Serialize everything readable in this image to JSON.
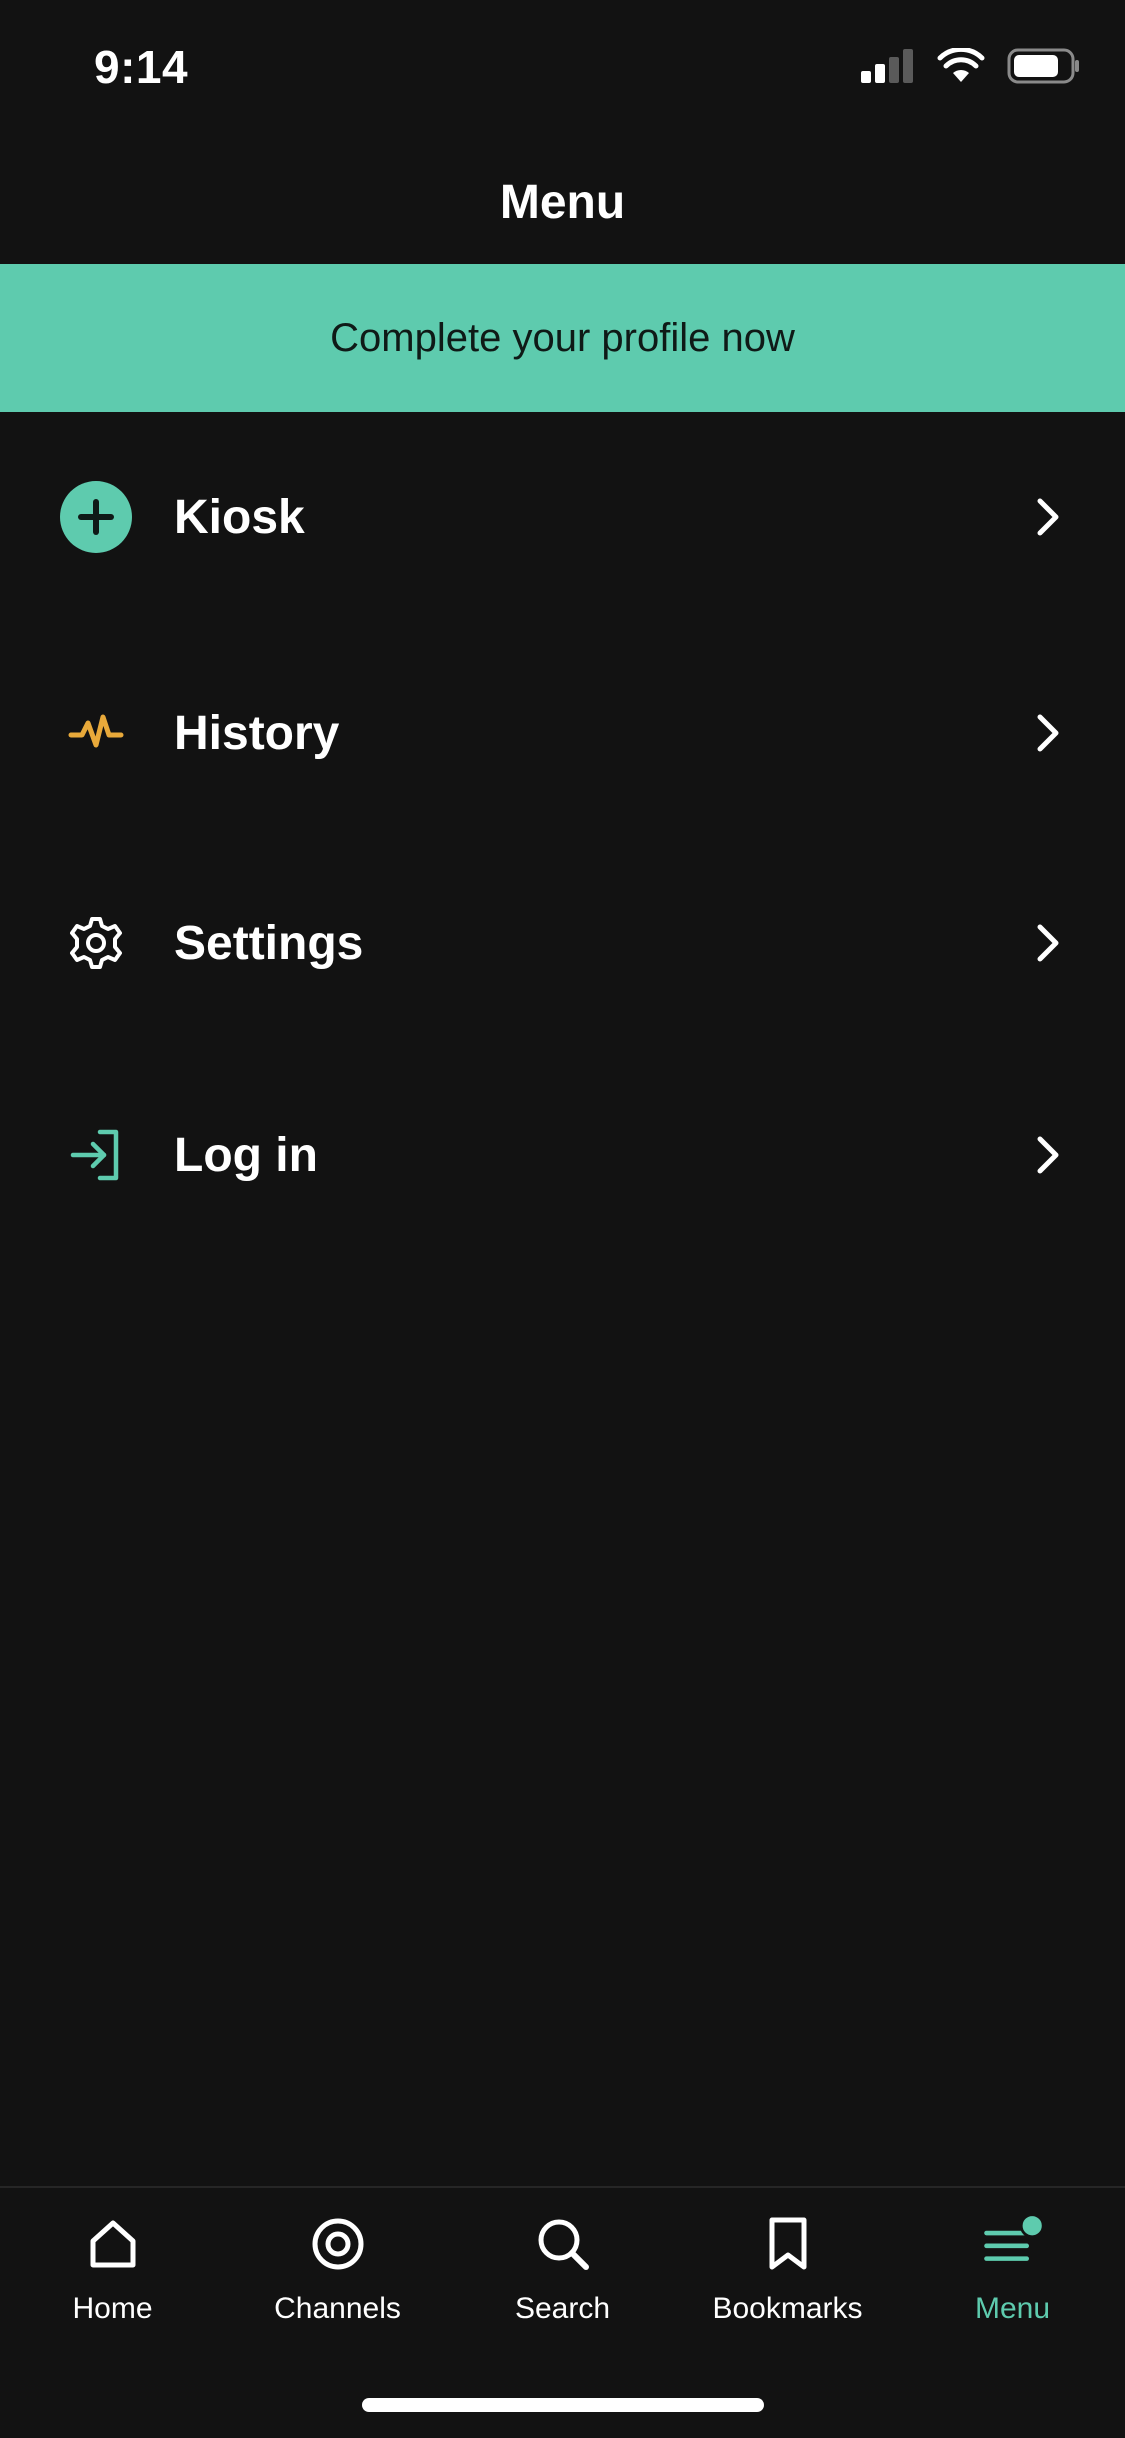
{
  "status_bar": {
    "time": "9:14"
  },
  "header": {
    "title": "Menu"
  },
  "banner": {
    "text": "Complete your profile now"
  },
  "menu_items": [
    {
      "label": "Kiosk",
      "icon": "plus-circle-icon"
    },
    {
      "label": "History",
      "icon": "activity-pulse-icon"
    },
    {
      "label": "Settings",
      "icon": "gear-icon"
    },
    {
      "label": "Log in",
      "icon": "login-arrow-icon"
    }
  ],
  "tab_bar": {
    "tabs": [
      {
        "label": "Home",
        "icon": "home-icon"
      },
      {
        "label": "Channels",
        "icon": "channels-target-icon"
      },
      {
        "label": "Search",
        "icon": "search-icon"
      },
      {
        "label": "Bookmarks",
        "icon": "bookmark-icon"
      },
      {
        "label": "Menu",
        "icon": "menu-lines-icon"
      }
    ],
    "active_tab": "Menu"
  },
  "colors": {
    "background": "#121212",
    "accent": "#5ecbae",
    "history_icon": "#e8a93a",
    "text": "#ffffff"
  }
}
